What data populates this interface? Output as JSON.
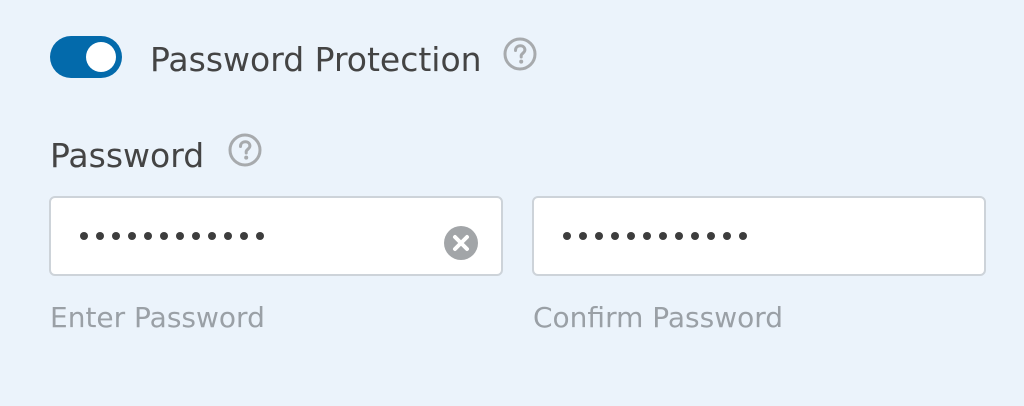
{
  "password_protection": {
    "toggle_label": "Password Protection",
    "enabled": true,
    "accent_color": "#036aab",
    "help_icon": "question-circle-icon"
  },
  "password": {
    "label": "Password",
    "help_icon": "question-circle-icon",
    "enter_field": {
      "masked_length": 12,
      "sublabel": "Enter Password",
      "clear_icon": "clear-x-icon"
    },
    "confirm_field": {
      "masked_length": 12,
      "sublabel": "Confirm Password"
    }
  }
}
